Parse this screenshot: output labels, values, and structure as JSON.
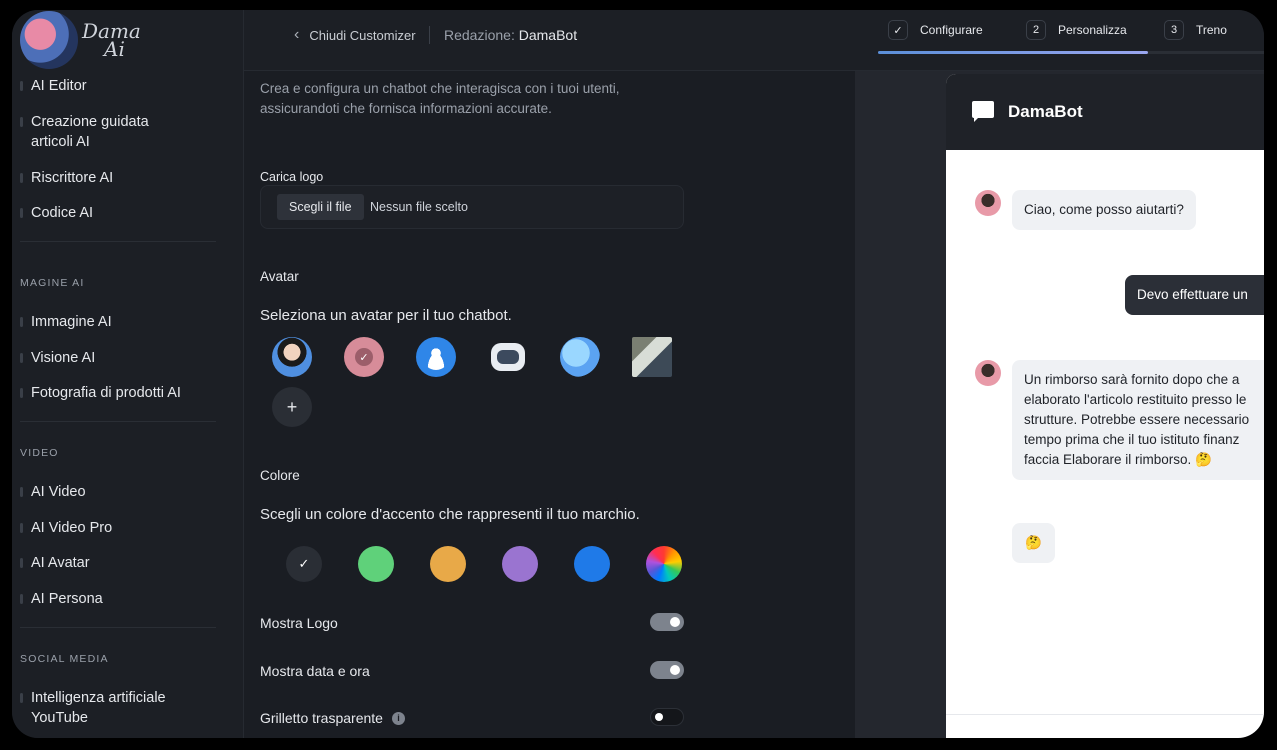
{
  "brand": {
    "logo_text_1": "Dama",
    "logo_text_2": "Ai"
  },
  "sidebar": {
    "items_group1": [
      "AI Editor",
      "Creazione guidata articoli AI",
      "Riscrittore AI",
      "Codice AI"
    ],
    "section_image": "MAGINE AI",
    "items_group2": [
      "Immagine AI",
      "Visione AI",
      "Fotografia di prodotti AI"
    ],
    "section_video": "VIDEO",
    "items_group3": [
      "AI Video",
      "AI Video Pro",
      "AI Avatar",
      "AI Persona"
    ],
    "section_social": "SOCIAL MEDIA",
    "items_group4": [
      "Intelligenza artificiale YouTube"
    ]
  },
  "topbar": {
    "back_label": "Chiudi Customizer",
    "editing_prefix": "Redazione:",
    "editing_name": "DamaBot",
    "steps": [
      {
        "marker": "✓",
        "label": "Configurare"
      },
      {
        "marker": "2",
        "label": "Personalizza"
      },
      {
        "marker": "3",
        "label": "Treno"
      }
    ]
  },
  "config": {
    "intro": "Crea e configura un chatbot che interagisca con i tuoi utenti, assicurandoti che fornisca informazioni accurate.",
    "logo_label": "Carica logo",
    "file_button": "Scegli il file",
    "file_none": "Nessun file scelto",
    "avatar_title": "Avatar",
    "avatar_desc": "Seleziona un avatar per il tuo chatbot.",
    "add_avatar": "+",
    "color_title": "Colore",
    "color_desc": "Scegli un colore d'accento che rappresenti il tuo marchio.",
    "colors": [
      "#2a2e35",
      "#5fd17a",
      "#e8a948",
      "#9a74d0",
      "#1f7ae8"
    ],
    "selected_color_marker": "✓",
    "toggles": [
      {
        "label": "Mostra Logo",
        "on": true
      },
      {
        "label": "Mostra data e ora",
        "on": true
      },
      {
        "label": "Grilletto trasparente",
        "on": false,
        "info": "i"
      }
    ]
  },
  "preview": {
    "bot_name": "DamaBot",
    "messages": [
      {
        "from": "bot",
        "text": "Ciao, come posso aiutarti?"
      },
      {
        "from": "user",
        "text": "Devo effettuare un"
      },
      {
        "from": "bot",
        "text": "Un rimborso sarà fornito dopo che a elaborato l'articolo restituito presso le strutture. Potrebbe essere necessario tempo prima che il tuo istituto finanz faccia Elaborare il rimborso. 🤔"
      },
      {
        "from": "bot",
        "text": "🤔"
      }
    ]
  }
}
